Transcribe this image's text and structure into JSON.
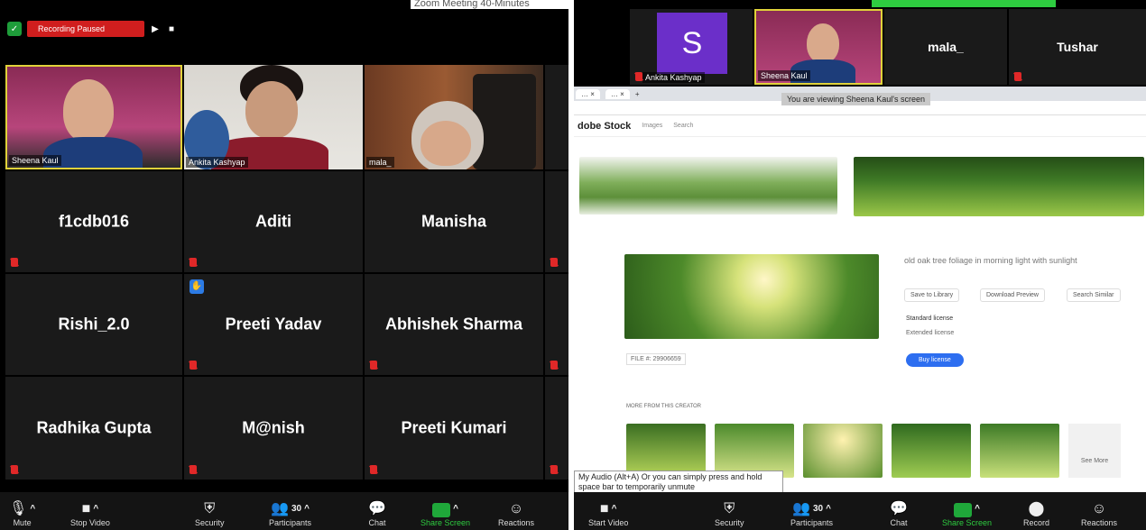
{
  "window_title": "Zoom Meeting 40-Minutes",
  "left": {
    "recording_label": "Recording Paused",
    "video_tiles": [
      {
        "name": "Sheena Kaul"
      },
      {
        "name": "Ankita Kashyap"
      },
      {
        "name": "mala_"
      }
    ],
    "name_tiles": [
      {
        "name": "f1cdb016"
      },
      {
        "name": "Aditi"
      },
      {
        "name": "Manisha"
      },
      {
        "name": "Rishi_2.0"
      },
      {
        "name": "Preeti Yadav"
      },
      {
        "name": "Abhishek Sharma"
      },
      {
        "name": "Radhika Gupta"
      },
      {
        "name": "M@nish"
      },
      {
        "name": "Preeti Kumari"
      }
    ],
    "toolbar": {
      "mute": "Mute",
      "stop_video": "Stop Video",
      "security": "Security",
      "participants": "Participants",
      "participants_count": "30",
      "chat": "Chat",
      "share_screen": "Share Screen",
      "reactions": "Reactions"
    }
  },
  "right": {
    "strip": {
      "avatar_letter": "S",
      "tiles": [
        {
          "name": "Ankita Kashyap"
        },
        {
          "name": "Sheena Kaul"
        },
        {
          "name": "mala_"
        },
        {
          "name": "Tushar"
        }
      ]
    },
    "share_tip": "You are viewing Sheena Kaul's screen",
    "browser": {
      "site_logo": "dobe Stock",
      "search_select": "Images",
      "search_placeholder": "Search",
      "item_title": "old oak tree foliage in morning light with sunlight",
      "btn_save": "Save to Library",
      "btn_download": "Download Preview",
      "btn_similar": "Search Similar",
      "license_standard": "Standard license",
      "license_extended": "Extended license",
      "buy_button": "Buy license",
      "file_id": "FILE #: 29906659",
      "see_more": "See More",
      "section_label": "MORE FROM THIS CREATOR"
    },
    "audio_tip": "My Audio (Alt+A) Or you can simply press and hold space bar to temporarily unmute",
    "toolbar": {
      "start_video": "Start Video",
      "security": "Security",
      "participants": "Participants",
      "participants_count": "30",
      "chat": "Chat",
      "share_screen": "Share Screen",
      "record": "Record",
      "reactions": "Reactions"
    }
  },
  "colors": {
    "recording": "#d01e1e",
    "share_green": "#1fa83a",
    "mic_red": "#e02828",
    "avatar_purple": "#6b2fc9",
    "active_border": "#e0d23a"
  }
}
